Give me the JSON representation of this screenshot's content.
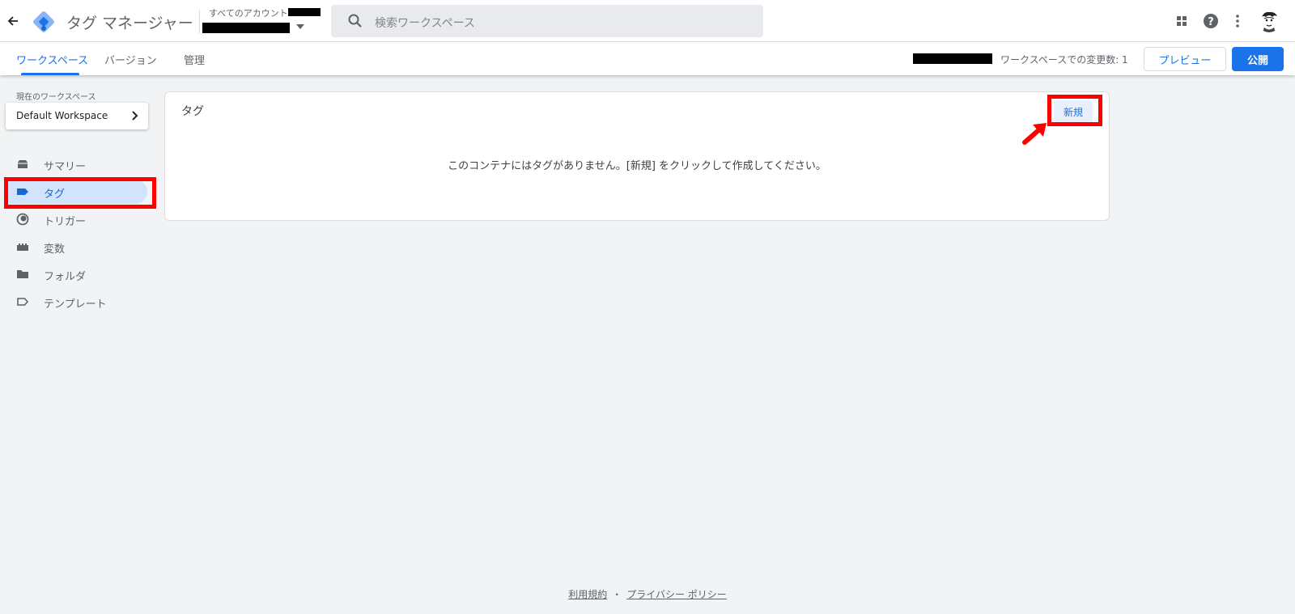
{
  "app": {
    "title": "タグ マネージャー"
  },
  "header": {
    "account_crumb": "すべてのアカウント >",
    "search_placeholder": "検索ワークスペース"
  },
  "icons": {
    "back": "arrow-left-icon",
    "logo": "gtm-logo",
    "apps": "apps-grid-icon",
    "help": "help-icon",
    "more": "more-vert-icon"
  },
  "tabs": [
    {
      "label": "ワークスペース",
      "active": true
    },
    {
      "label": "バージョン",
      "active": false
    },
    {
      "label": "管理",
      "active": false
    }
  ],
  "toolbar": {
    "changes_label": "ワークスペースでの変更数: 1",
    "preview_label": "プレビュー",
    "publish_label": "公開"
  },
  "sidebar": {
    "current_ws_label": "現在のワークスペース",
    "workspace_name": "Default Workspace",
    "items": [
      {
        "label": "サマリー",
        "icon": "summary-icon",
        "active": false
      },
      {
        "label": "タグ",
        "icon": "tag-icon",
        "active": true
      },
      {
        "label": "トリガー",
        "icon": "trigger-icon",
        "active": false
      },
      {
        "label": "変数",
        "icon": "variables-icon",
        "active": false
      },
      {
        "label": "フォルダ",
        "icon": "folder-icon",
        "active": false
      },
      {
        "label": "テンプレート",
        "icon": "template-icon",
        "active": false
      }
    ]
  },
  "main": {
    "card_title": "タグ",
    "new_label": "新規",
    "empty_message": "このコンテナにはタグがありません。[新規] をクリックして作成してください。"
  },
  "footer": {
    "terms": "利用規約",
    "separator": "・",
    "privacy": "プライバシー ポリシー"
  },
  "colors": {
    "accent": "#1a73e8",
    "annotation": "#ff0000",
    "background": "#f1f3f4"
  }
}
